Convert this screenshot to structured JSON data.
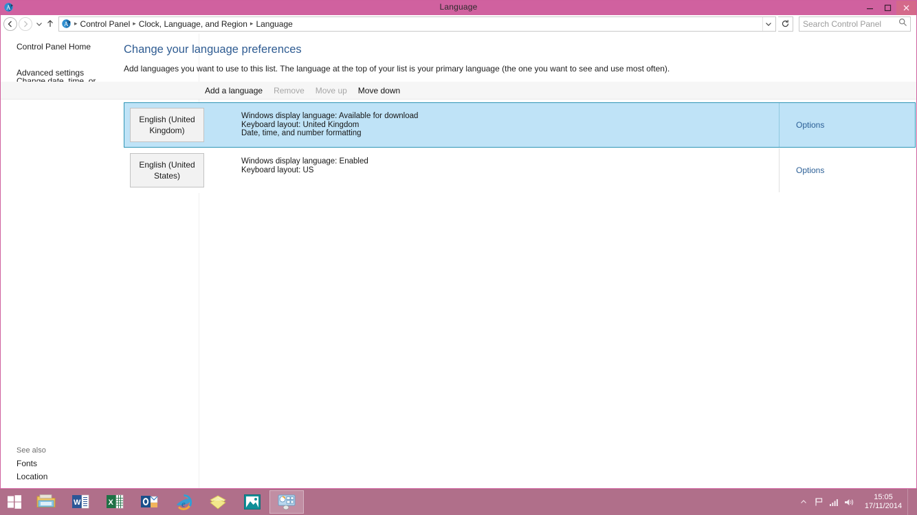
{
  "window": {
    "title": "Language",
    "icon": "language-app-icon",
    "controls": {
      "minimize": "Minimize",
      "maximize": "Maximize",
      "close": "Close"
    }
  },
  "navbar": {
    "back": "Back",
    "forward": "Forward",
    "recent_locations": "Recent locations",
    "up": "Up one level",
    "breadcrumb": [
      "Control Panel",
      "Clock, Language, and Region",
      "Language"
    ],
    "breadcrumb_separator": "▸",
    "address_chevron": "∨",
    "refresh": "Refresh",
    "search": {
      "placeholder": "Search Control Panel",
      "value": "",
      "icon": "search-icon"
    }
  },
  "sidebar": {
    "home": "Control Panel Home",
    "tasks": [
      "Advanced settings",
      "Change date, time, or number formats"
    ],
    "see_also_label": "See also",
    "see_also": [
      "Fonts",
      "Location"
    ]
  },
  "main": {
    "heading": "Change your language preferences",
    "description": "Add languages you want to use to this list. The language at the top of your list is your primary language (the one you want to see and use most often).",
    "toolbar": [
      {
        "label": "Add a language",
        "enabled": true
      },
      {
        "label": "Remove",
        "enabled": false
      },
      {
        "label": "Move up",
        "enabled": false
      },
      {
        "label": "Move down",
        "enabled": true
      }
    ],
    "languages": [
      {
        "name": "English (United Kingdom)",
        "details": [
          "Windows display language: Available for download",
          "Keyboard layout: United Kingdom",
          "Date, time, and number formatting"
        ],
        "options_label": "Options",
        "selected": true
      },
      {
        "name": "English (United States)",
        "details": [
          "Windows display language: Enabled",
          "Keyboard layout: US"
        ],
        "options_label": "Options",
        "selected": false
      }
    ]
  },
  "taskbar": {
    "start": "start-button",
    "items": [
      {
        "name": "file-explorer-icon",
        "state": "pinned"
      },
      {
        "name": "word-icon",
        "state": "pinned"
      },
      {
        "name": "excel-icon",
        "state": "pinned"
      },
      {
        "name": "outlook-icon",
        "state": "pinned"
      },
      {
        "name": "internet-explorer-icon",
        "state": "pinned"
      },
      {
        "name": "sticky-notes-icon",
        "state": "pinned"
      },
      {
        "name": "photos-icon",
        "state": "pinned"
      },
      {
        "name": "control-panel-icon",
        "state": "active"
      }
    ],
    "tray": {
      "show_hidden": "▲",
      "icons": [
        "flag-icon",
        "network-icon",
        "volume-icon"
      ],
      "time": "15:05",
      "date": "17/11/2014"
    }
  },
  "colors": {
    "titlebar": "#d0619f",
    "taskbar": "#b06f8a",
    "selection": "#bfe3f7",
    "selection_border": "#2e95b5",
    "heading": "#2f5c92",
    "link": "#2b5f96"
  }
}
